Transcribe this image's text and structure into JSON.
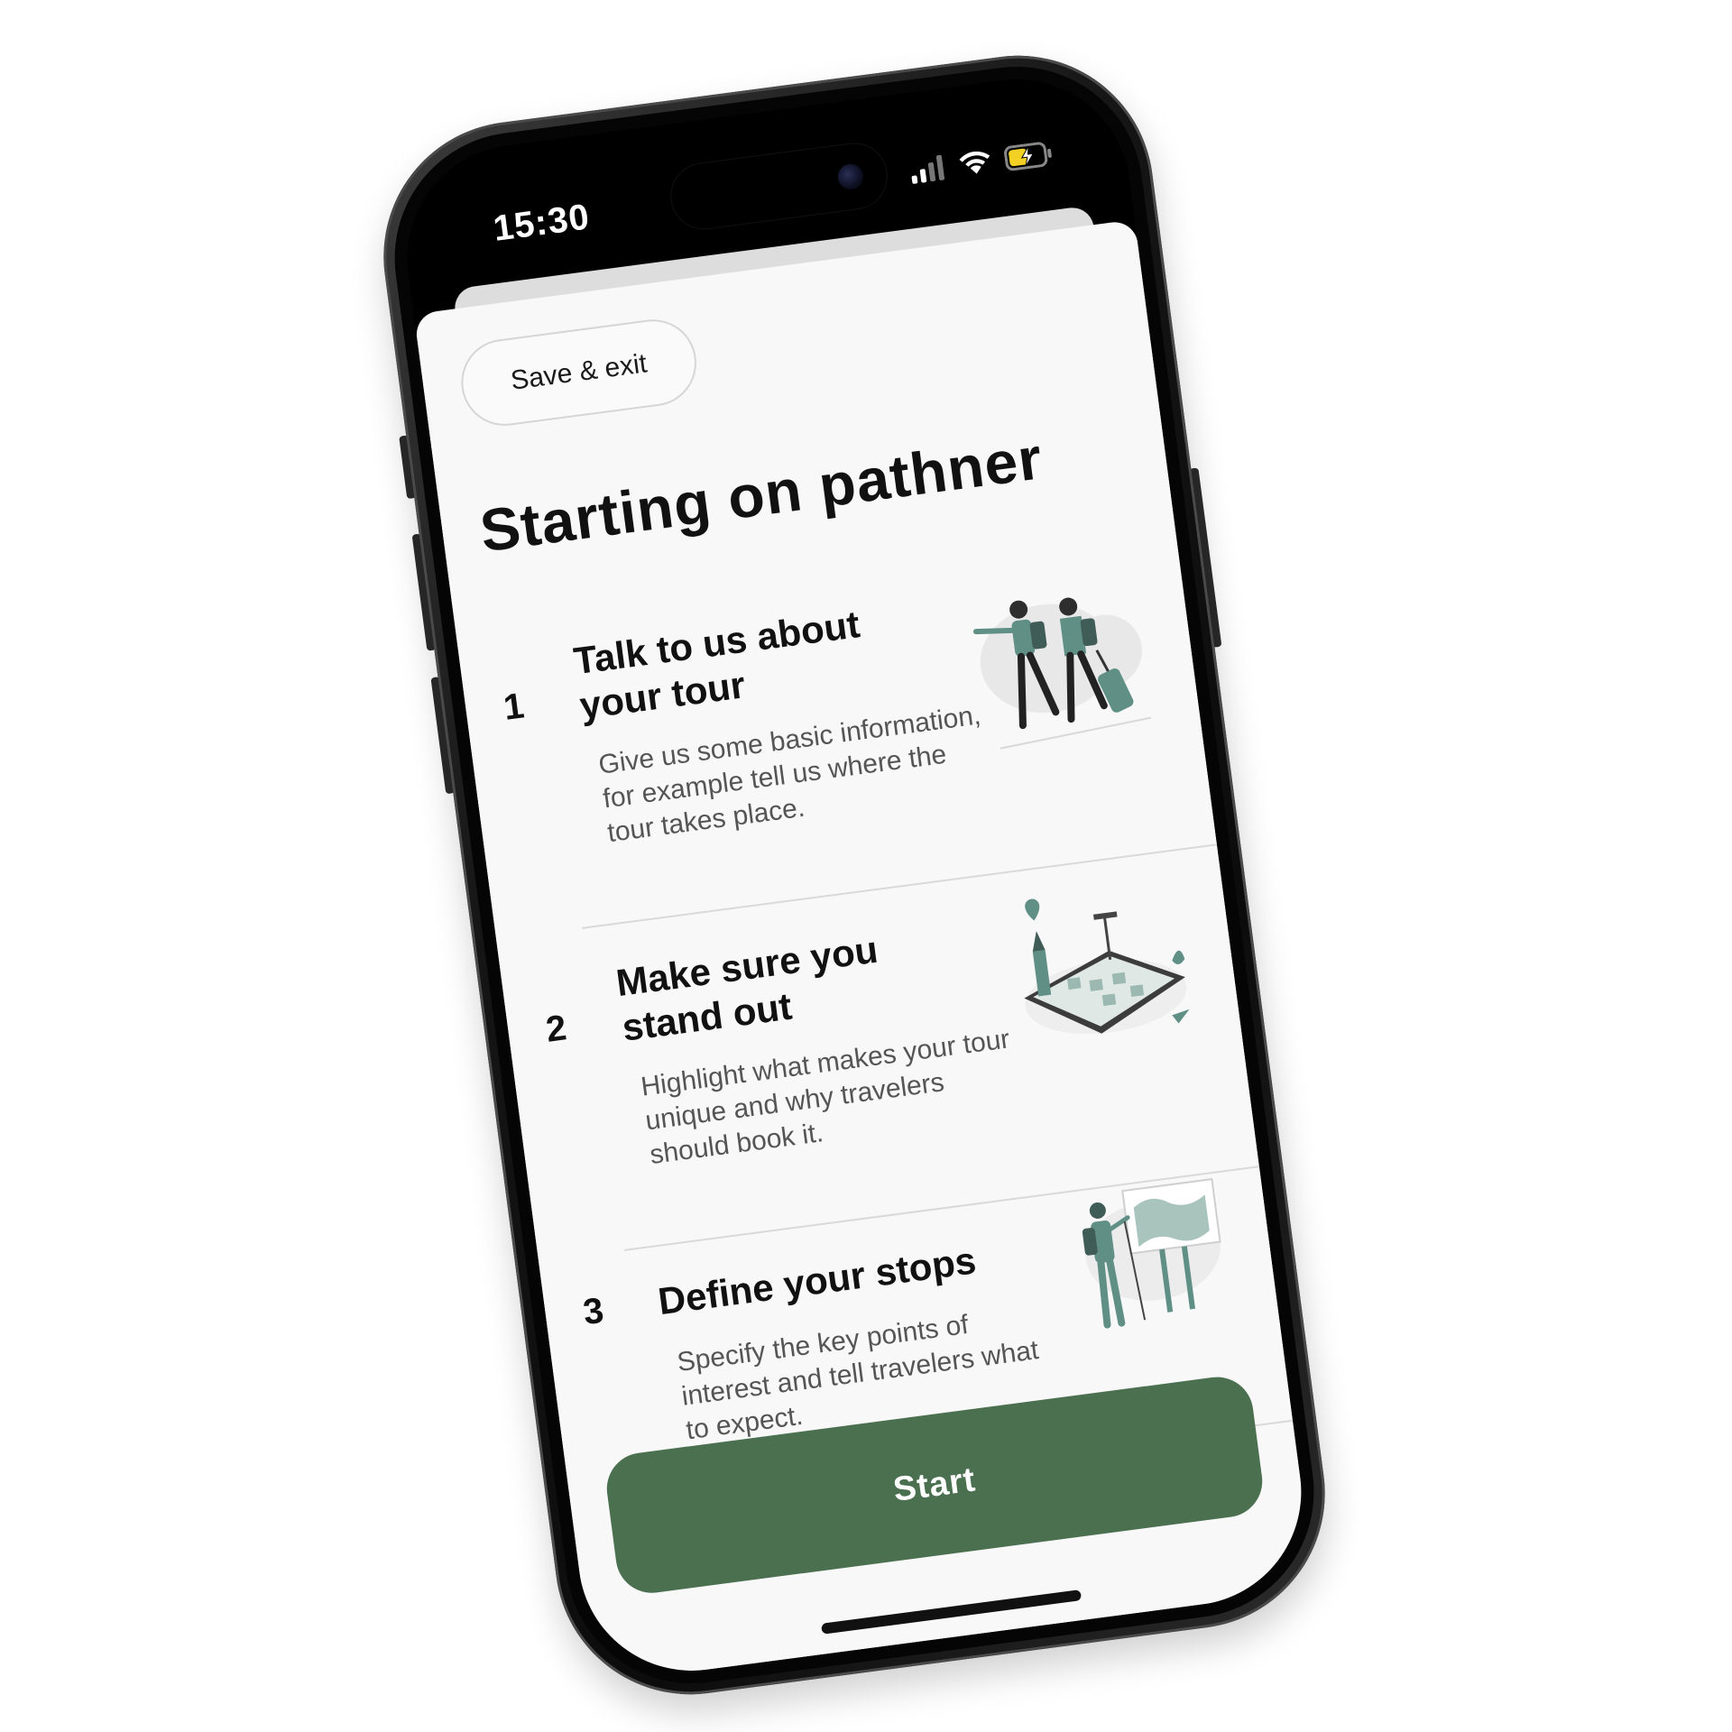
{
  "status_bar": {
    "time": "15:30"
  },
  "header": {
    "save_exit_label": "Save & exit"
  },
  "page": {
    "title": "Starting on pathner"
  },
  "steps": [
    {
      "number": "1",
      "title": "Talk to us about your tour",
      "description": "Give us some basic information, for example tell us where the tour takes place.",
      "illustration": "travelers-walking-illustration"
    },
    {
      "number": "2",
      "title": "Make sure you stand out",
      "description": "Highlight what makes your tour unique and why travelers should book it.",
      "illustration": "city-map-tablet-illustration"
    },
    {
      "number": "3",
      "title": "Define your stops",
      "description": "Specify the key points of interest and tell travelers what to expect.",
      "illustration": "hiker-map-board-illustration"
    }
  ],
  "footer": {
    "start_label": "Start"
  },
  "colors": {
    "accent": "#4a7050",
    "illustration_teal": "#5f8f85",
    "background": "#f8f8f8",
    "text": "#111111",
    "muted_text": "#555555"
  },
  "icons": [
    "signal-icon",
    "wifi-icon",
    "battery-charging-icon",
    "camera-icon"
  ]
}
